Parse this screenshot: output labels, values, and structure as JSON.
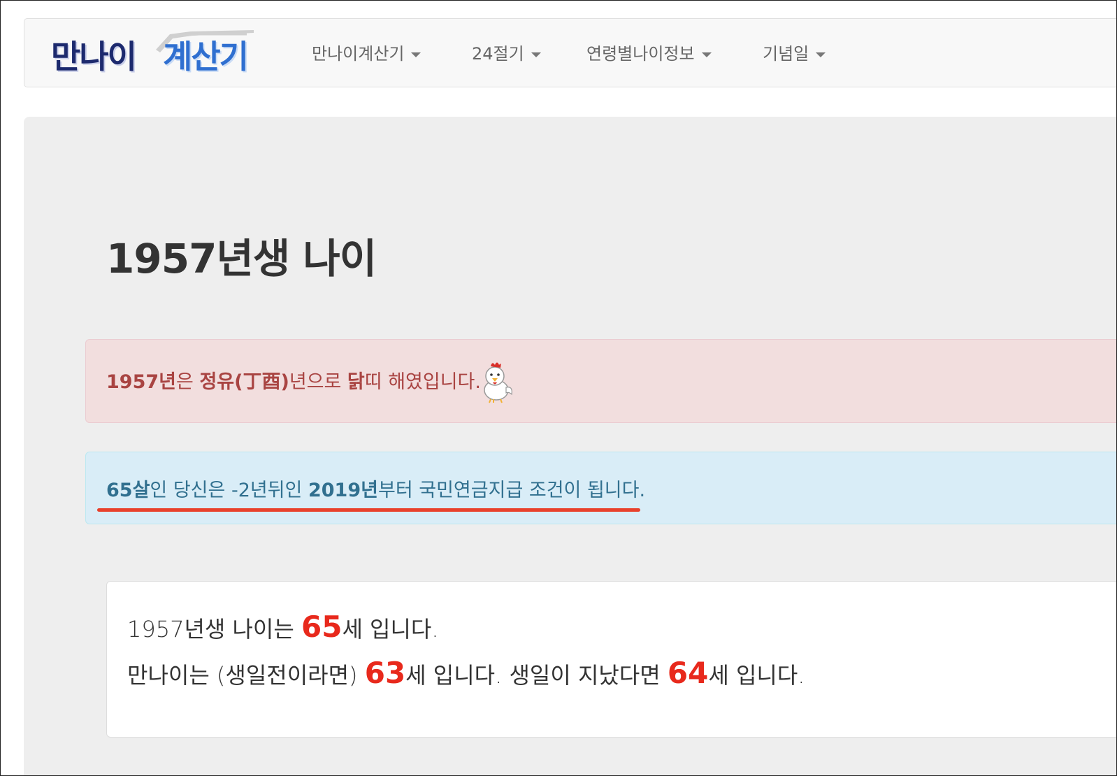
{
  "navbar": {
    "brand": {
      "part1": "만나이",
      "part2": "계산기"
    },
    "items": [
      {
        "label": "만나이계산기"
      },
      {
        "label": "24절기"
      },
      {
        "label": "연령별나이정보"
      },
      {
        "label": "기념일"
      }
    ]
  },
  "main": {
    "title": "1957년생 나이",
    "zodiac_alert": {
      "year": "1957년",
      "t1": "은 ",
      "ganji": "정유(丁酉)",
      "t2": "년으로 ",
      "animal": "닭",
      "t3": "띠 해였입니다."
    },
    "pension_alert": {
      "age": "65살",
      "t1": "인 당신은 -2년뒤인 ",
      "year": "2019년",
      "t2": "부터 국민연금지급 조건이 됩니다."
    },
    "result": {
      "l1_prefix": "1957년생 나이는 ",
      "age": "65",
      "l1_suffix": "세 입니다.",
      "l2_prefix": "만나이는 (생일전이라면) ",
      "age_before": "63",
      "l2_mid": "세 입니다. 생일이 지났다면 ",
      "age_after": "64",
      "l2_suffix": "세 입니다."
    }
  },
  "colors": {
    "danger_text": "#a94442",
    "info_text": "#31708f",
    "highlight_red": "#e8291c",
    "underline": "#e8412c"
  },
  "icons": {
    "mascot": "rooster-chick-icon"
  }
}
